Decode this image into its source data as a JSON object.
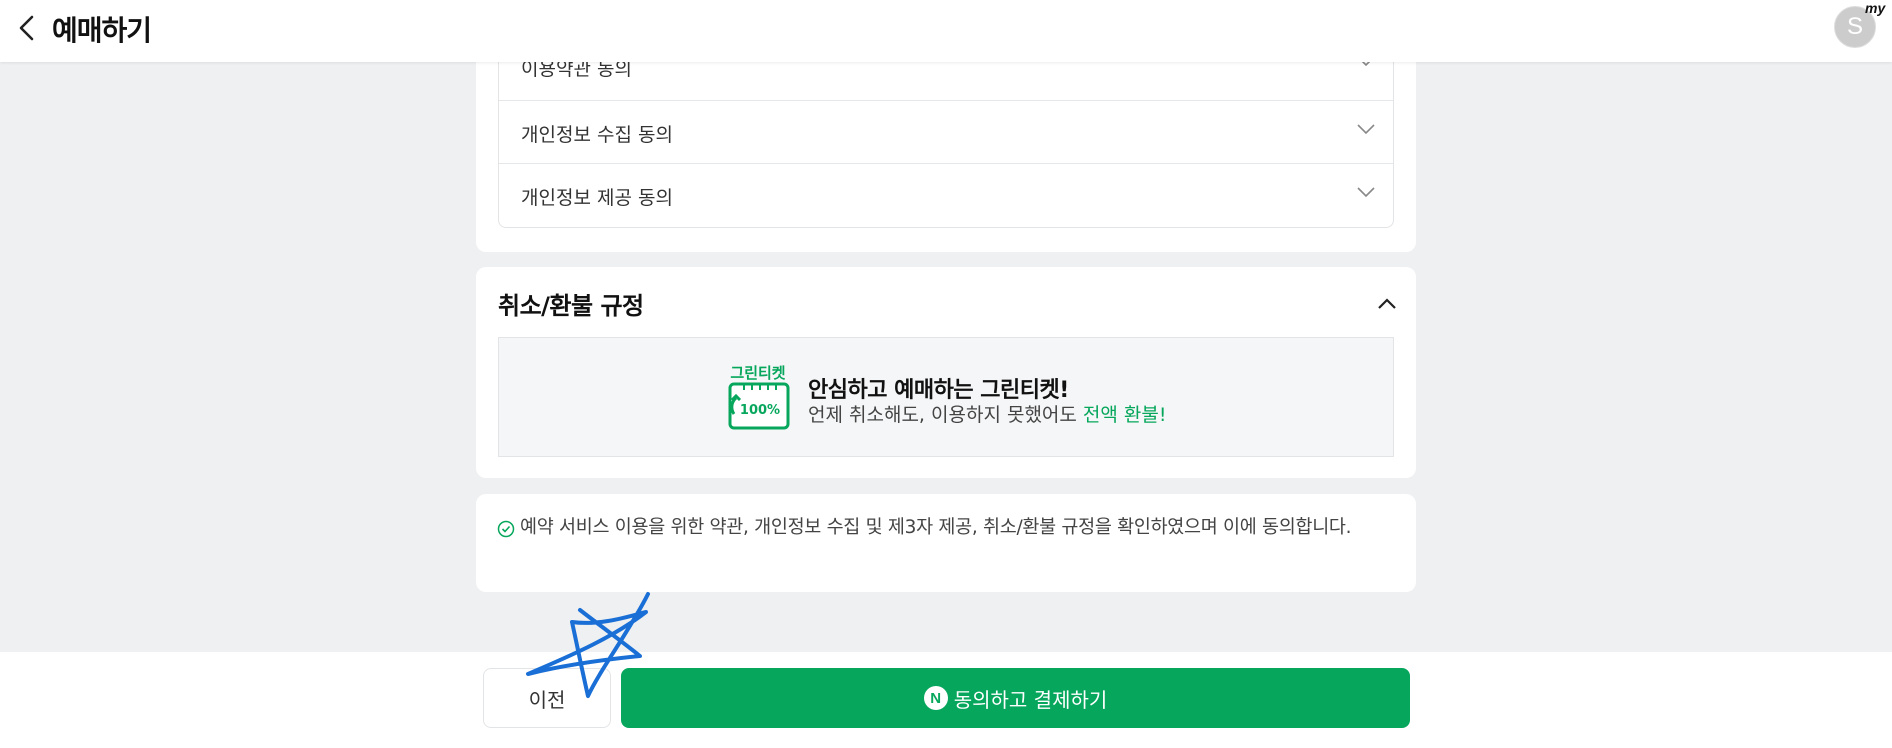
{
  "header": {
    "title": "예매하기",
    "avatar_initial": "S",
    "avatar_badge": "my"
  },
  "terms": {
    "items": [
      {
        "label": "이용약관 동의"
      },
      {
        "label": "개인정보 수집 동의"
      },
      {
        "label": "개인정보 제공 동의"
      }
    ]
  },
  "refund": {
    "title": "취소/환불 규정",
    "logo_text": "그린티켓",
    "logo_badge": "100%",
    "headline": "안심하고 예매하는 그린티켓!",
    "sub_prefix": "언제 취소해도, 이용하지 못했어도 ",
    "sub_highlight": "전액 환불!"
  },
  "agreement": {
    "text": "예약 서비스 이용을 위한 약관, 개인정보 수집 및 제3자 제공, 취소/환불 규정을 확인하였으며 이에 동의합니다."
  },
  "actions": {
    "prev_label": "이전",
    "pay_icon": "N",
    "pay_label": "동의하고 결제하기"
  },
  "colors": {
    "brand_green": "#06a75c",
    "page_bg": "#eff0f2",
    "annotation_blue": "#1a6fd6"
  }
}
